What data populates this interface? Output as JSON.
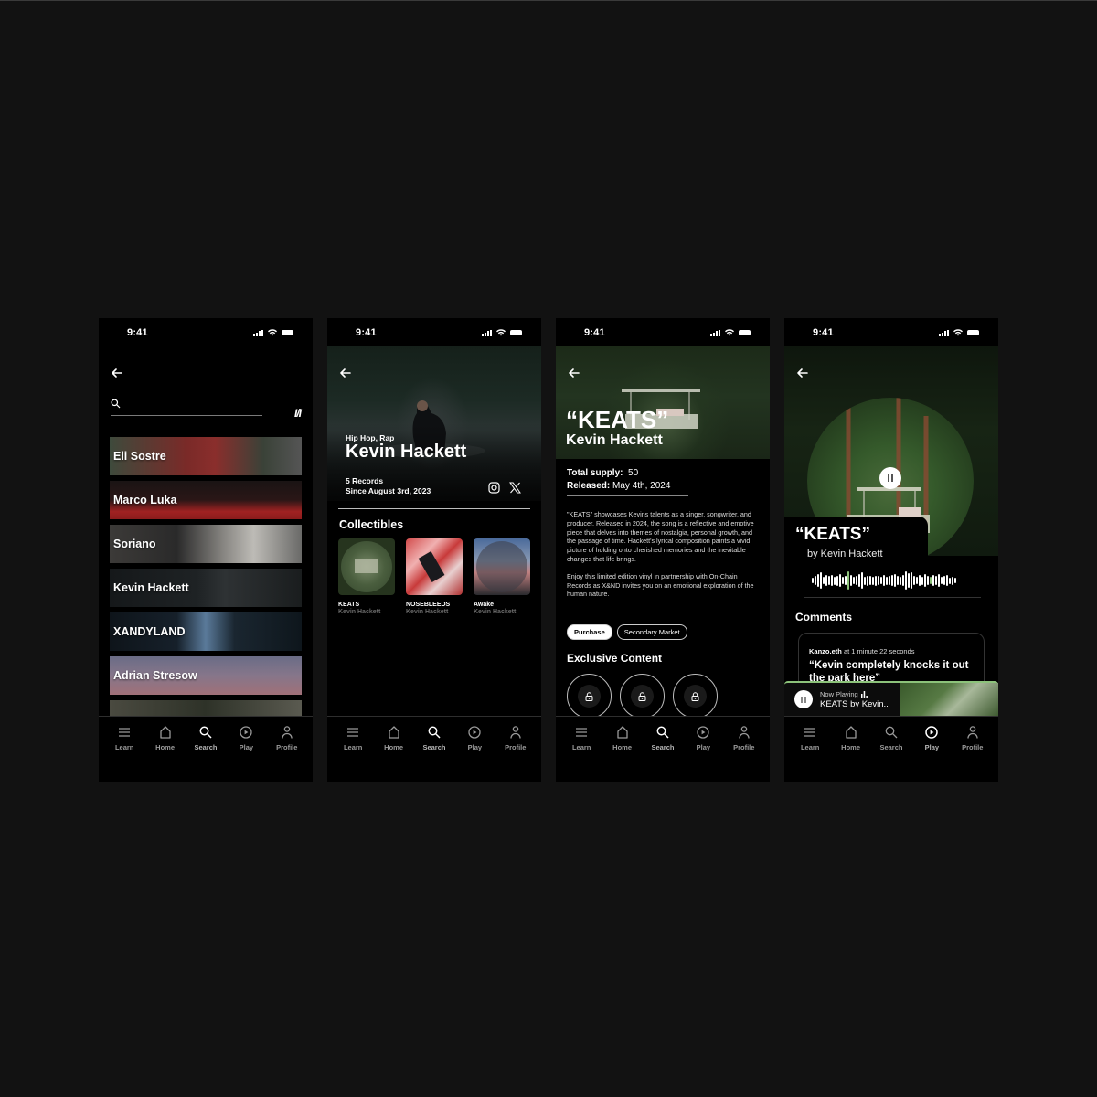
{
  "status_bar": {
    "time": "9:41"
  },
  "nav": {
    "items": [
      {
        "label": "Learn",
        "icon": "menu-icon"
      },
      {
        "label": "Home",
        "icon": "home-icon"
      },
      {
        "label": "Search",
        "icon": "search-icon"
      },
      {
        "label": "Play",
        "icon": "play-circle-icon"
      },
      {
        "label": "Profile",
        "icon": "profile-icon"
      }
    ]
  },
  "screen1": {
    "search_placeholder": "",
    "logo": "I/I",
    "artists": [
      {
        "name": "Eli Sostre",
        "color": "#7a2a28"
      },
      {
        "name": "Marco Luka",
        "color": "#9a2020"
      },
      {
        "name": "Soriano",
        "color": "#5a5a5a"
      },
      {
        "name": "Kevin Hackett",
        "color": "#222628"
      },
      {
        "name": "XANDYLAND",
        "color": "#111a22"
      },
      {
        "name": "Adrian Stresow",
        "color": "#7a6a82"
      },
      {
        "name": "",
        "color": "#3a3a30"
      }
    ]
  },
  "screen2": {
    "genre": "Hip Hop, Rap",
    "artist": "Kevin Hackett",
    "records": "5 Records",
    "since": "Since August 3rd, 2023",
    "collectibles_title": "Collectibles",
    "collectibles": [
      {
        "title": "KEATS",
        "artist": "Kevin Hackett"
      },
      {
        "title": "NOSEBLEEDS",
        "artist": "Kevin Hackett"
      },
      {
        "title": "Awake",
        "artist": "Kevin Hackett"
      }
    ]
  },
  "screen3": {
    "title": "“KEATS”",
    "artist": "Kevin Hackett",
    "supply_label": "Total supply:",
    "supply_value": "50",
    "released_label": "Released:",
    "released_value": "May 4th, 2024",
    "description_1": "\"KEATS\" showcases Kevins talents as a singer, songwriter, and producer. Released in 2024, the song is a reflective and emotive piece that delves into themes of nostalgia, personal growth, and the passage of time. Hackett's lyrical composition paints a vivid picture of holding onto cherished memories and the inevitable changes that life brings.",
    "description_2": "Enjoy this limited edition vinyl in partnership with On-Chain Records as X&ND invites you on an emotional exploration of the human nature.",
    "purchase_label": "Purchase",
    "secondary_label": "Secondary Market",
    "exclusive_title": "Exclusive Content",
    "locked_items": 3
  },
  "screen4": {
    "title": "“KEATS”",
    "by": "by Kevin Hackett",
    "comments_title": "Comments",
    "comment": {
      "user": "Kanzo.eth",
      "timestamp": "at 1 minute 22 seconds",
      "text": "“Kevin completely knocks it out the park here”"
    },
    "now_playing_label": "Now Playing",
    "now_playing_track": "KEATS by Kevin..",
    "accent": "#8cc27a"
  }
}
